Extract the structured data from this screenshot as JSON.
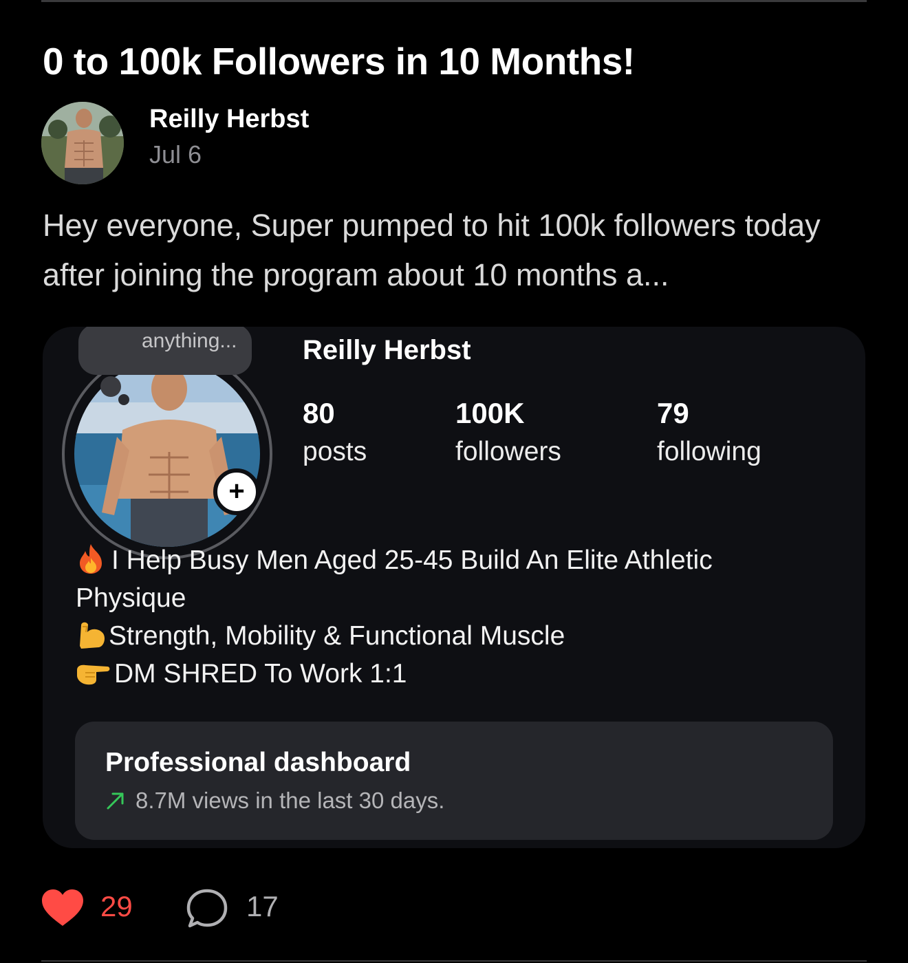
{
  "post": {
    "title": "0 to 100k Followers in 10 Months!",
    "author": "Reilly Herbst",
    "date": "Jul 6",
    "body": "Hey everyone, Super pumped to hit 100k followers today after joining the program about 10 months a...",
    "likes": "29",
    "comments": "17"
  },
  "embedded_profile": {
    "note_text": "anything...",
    "name": "Reilly Herbst",
    "stats": [
      {
        "value": "80",
        "label": "posts"
      },
      {
        "value": "100K",
        "label": "followers"
      },
      {
        "value": "79",
        "label": "following"
      }
    ],
    "bio": {
      "line1": "I Help Busy Men Aged 25-45 Build An Elite Athletic",
      "line2": "Physique",
      "line3": "Strength, Mobility & Functional Muscle",
      "line4": "DM SHRED To Work 1:1"
    },
    "dashboard": {
      "title": "Professional dashboard",
      "subtitle": "8.7M views in the last 30 days."
    }
  },
  "icons": {
    "fire": "fire-icon",
    "muscle": "flexed-biceps-icon",
    "pointing": "pointing-hand-icon",
    "trend": "trend-up-arrow-icon",
    "like": "heart-icon",
    "comment": "comment-bubble-icon"
  },
  "colors": {
    "background": "#000000",
    "like": "#ff4b45",
    "trend": "#35c759",
    "muted": "#8e8e93"
  }
}
